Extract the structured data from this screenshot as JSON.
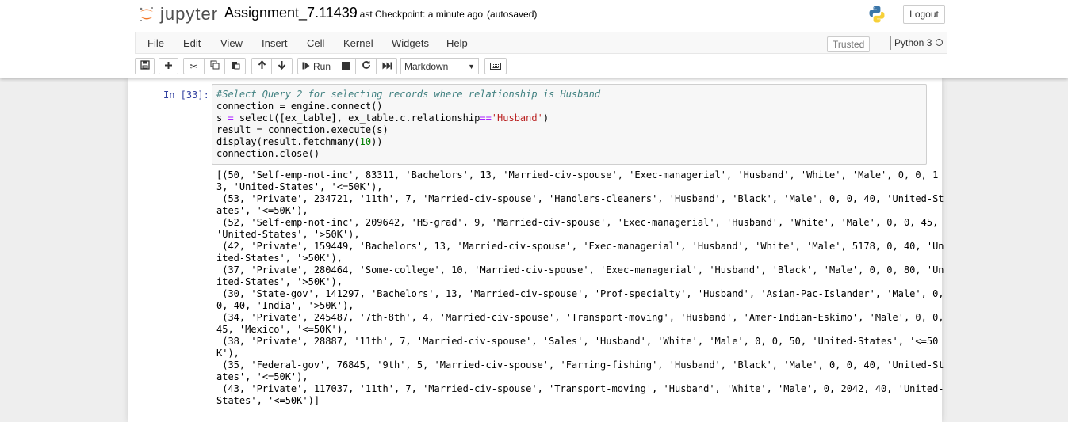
{
  "header": {
    "logo_text": "jupyter",
    "notebook_name": "Assignment_7.11439",
    "checkpoint": "Last Checkpoint: a minute ago",
    "autosave": "(autosaved)",
    "logout_label": "Logout"
  },
  "menubar": {
    "items": [
      "File",
      "Edit",
      "View",
      "Insert",
      "Cell",
      "Kernel",
      "Widgets",
      "Help"
    ],
    "trusted": "Trusted",
    "kernel_name": "Python 3"
  },
  "toolbar": {
    "run_label": "Run",
    "cell_type": "Markdown"
  },
  "cell": {
    "prompt": "In [33]:",
    "code": {
      "comment": "#Select Query 2 for selecting records where relationship is Husband",
      "line2": "connection = engine.connect()",
      "line3_a": "s ",
      "line3_b": "= ",
      "line3_c": "select([ex_table], ex_table.c.relationship",
      "line3_d": "==",
      "line3_e": "'Husband'",
      "line3_f": ")",
      "line4": "result = connection.execute(s)",
      "line5_a": "display(result.fetchmany(",
      "line5_b": "10",
      "line5_c": "))",
      "line6": "connection.close()"
    },
    "output_lines": [
      "[(50, 'Self-emp-not-inc', 83311, 'Bachelors', 13, 'Married-civ-spouse', 'Exec-managerial', 'Husband', 'White', 'Male', 0, 0, 1",
      "3, 'United-States', '<=50K'),",
      " (53, 'Private', 234721, '11th', 7, 'Married-civ-spouse', 'Handlers-cleaners', 'Husband', 'Black', 'Male', 0, 0, 40, 'United-St",
      "ates', '<=50K'),",
      " (52, 'Self-emp-not-inc', 209642, 'HS-grad', 9, 'Married-civ-spouse', 'Exec-managerial', 'Husband', 'White', 'Male', 0, 0, 45,",
      "'United-States', '>50K'),",
      " (42, 'Private', 159449, 'Bachelors', 13, 'Married-civ-spouse', 'Exec-managerial', 'Husband', 'White', 'Male', 5178, 0, 40, 'Un",
      "ited-States', '>50K'),",
      " (37, 'Private', 280464, 'Some-college', 10, 'Married-civ-spouse', 'Exec-managerial', 'Husband', 'Black', 'Male', 0, 0, 80, 'Un",
      "ited-States', '>50K'),",
      " (30, 'State-gov', 141297, 'Bachelors', 13, 'Married-civ-spouse', 'Prof-specialty', 'Husband', 'Asian-Pac-Islander', 'Male', 0,",
      "0, 40, 'India', '>50K'),",
      " (34, 'Private', 245487, '7th-8th', 4, 'Married-civ-spouse', 'Transport-moving', 'Husband', 'Amer-Indian-Eskimo', 'Male', 0, 0,",
      "45, 'Mexico', '<=50K'),",
      " (38, 'Private', 28887, '11th', 7, 'Married-civ-spouse', 'Sales', 'Husband', 'White', 'Male', 0, 0, 50, 'United-States', '<=50",
      "K'),",
      " (35, 'Federal-gov', 76845, '9th', 5, 'Married-civ-spouse', 'Farming-fishing', 'Husband', 'Black', 'Male', 0, 0, 40, 'United-St",
      "ates', '<=50K'),",
      " (43, 'Private', 117037, '11th', 7, 'Married-civ-spouse', 'Transport-moving', 'Husband', 'White', 'Male', 0, 2042, 40, 'United-",
      "States', '<=50K')]"
    ]
  }
}
